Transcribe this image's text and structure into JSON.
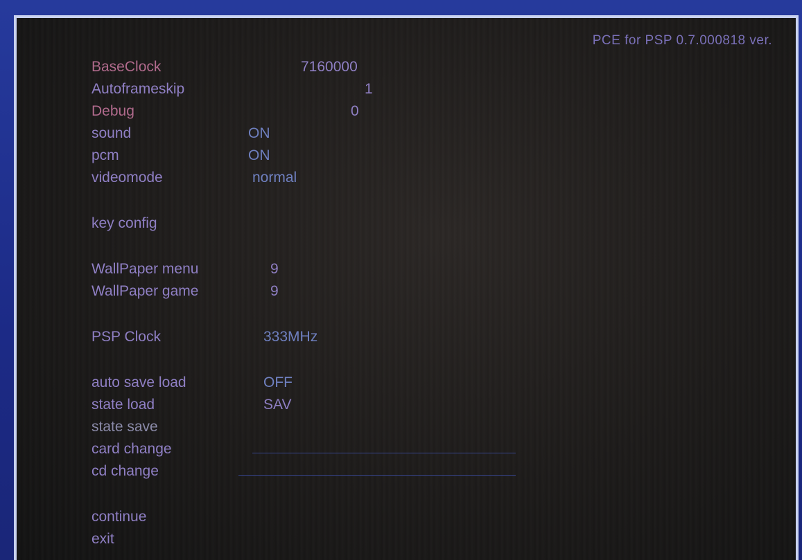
{
  "header": {
    "version": "PCE for PSP 0.7.000818 ver."
  },
  "menu": {
    "items": [
      {
        "label": "BaseClock",
        "value": "7160000"
      },
      {
        "label": "Autoframeskip",
        "value": "1"
      },
      {
        "label": "Debug",
        "value": "0"
      },
      {
        "label": "sound",
        "value": "ON"
      },
      {
        "label": "pcm",
        "value": "ON"
      },
      {
        "label": "videomode",
        "value": "normal"
      },
      {
        "label": "key config",
        "value": ""
      },
      {
        "label": "WallPaper menu",
        "value": "9"
      },
      {
        "label": "WallPaper game",
        "value": "9"
      },
      {
        "label": "PSP Clock",
        "value": "333MHz"
      },
      {
        "label": "auto save load",
        "value": "OFF"
      },
      {
        "label": "state load",
        "value": "SAV"
      },
      {
        "label": "state save",
        "value": ""
      },
      {
        "label": "card change",
        "value": ""
      },
      {
        "label": "cd change",
        "value": ""
      },
      {
        "label": "continue",
        "value": ""
      },
      {
        "label": "exit",
        "value": ""
      }
    ]
  },
  "colors": {
    "frame": "#1f2f8c",
    "screen_border": "#c9d2f0",
    "screen_bg": "#1c1a19",
    "label_highlight": "#b06a8c",
    "label_normal": "#8f7fc4",
    "value": "#6f80c0"
  }
}
